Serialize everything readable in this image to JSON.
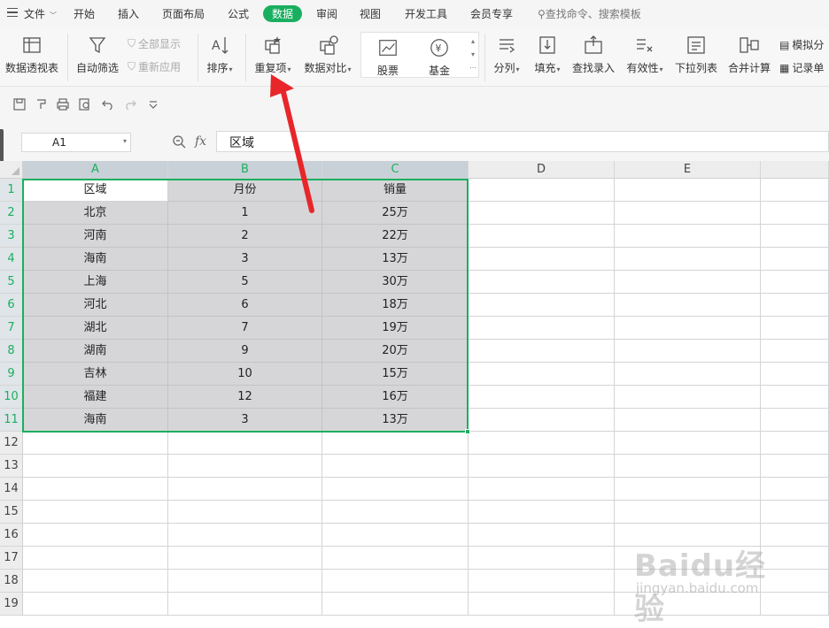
{
  "menubar": {
    "items": [
      "文件",
      "开始",
      "插入",
      "页面布局",
      "公式",
      "数据",
      "审阅",
      "视图",
      "开发工具",
      "会员专享"
    ],
    "active": "数据",
    "search_placeholder": "查找命令、搜索模板"
  },
  "ribbon": {
    "pivot": "数据透视表",
    "autofilter": "自动筛选",
    "show_all": "全部显示",
    "reapply": "重新应用",
    "sort": "排序",
    "duplicates": "重复项",
    "compare": "数据对比",
    "stocks": "股票",
    "funds": "基金",
    "split": "分列",
    "fill": "填充",
    "lookup": "查找录入",
    "validity": "有效性",
    "dropdown": "下拉列表",
    "consolidate": "合并计算",
    "simulate": "模拟分",
    "records": "记录单"
  },
  "formula_bar": {
    "name_box": "A1",
    "fx": "fx",
    "content": "区域"
  },
  "columns": [
    "A",
    "B",
    "C",
    "D",
    "E"
  ],
  "rows": [
    "1",
    "2",
    "3",
    "4",
    "5",
    "6",
    "7",
    "8",
    "9",
    "10",
    "11",
    "12",
    "13",
    "14",
    "15",
    "16",
    "17",
    "18",
    "19"
  ],
  "table": [
    [
      "区域",
      "月份",
      "销量"
    ],
    [
      "北京",
      "1",
      "25万"
    ],
    [
      "河南",
      "2",
      "22万"
    ],
    [
      "海南",
      "3",
      "13万"
    ],
    [
      "上海",
      "5",
      "30万"
    ],
    [
      "河北",
      "6",
      "18万"
    ],
    [
      "湖北",
      "7",
      "19万"
    ],
    [
      "湖南",
      "9",
      "20万"
    ],
    [
      "吉林",
      "10",
      "15万"
    ],
    [
      "福建",
      "12",
      "16万"
    ],
    [
      "海南",
      "3",
      "13万"
    ]
  ],
  "colors": {
    "accent": "#1aaf60",
    "arrow": "#e8262a",
    "selection_fill": "#d6d6d8"
  },
  "watermark": {
    "logo": "Baidu经验",
    "url": "jingyan.baidu.com"
  }
}
